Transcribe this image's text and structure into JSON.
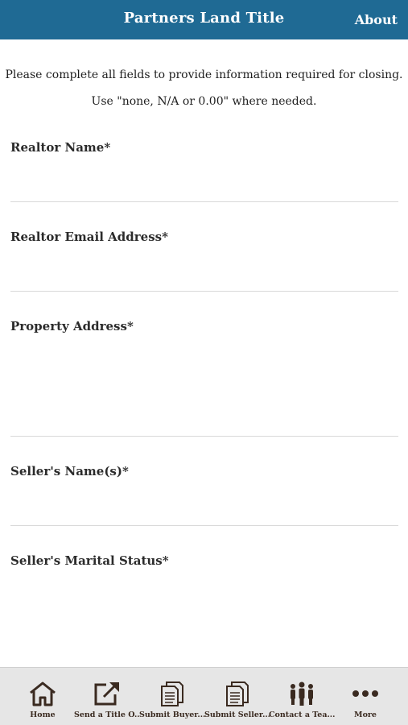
{
  "header": {
    "title": "Partners Land Title",
    "about": "About"
  },
  "intro": {
    "line1": "Please complete all fields to provide information required for closing.",
    "line2": "Use \"none, N/A or 0.00\" where needed."
  },
  "fields": [
    {
      "label": "Realtor Name*",
      "value": ""
    },
    {
      "label": "Realtor Email Address*",
      "value": ""
    },
    {
      "label": "Property Address*",
      "value": ""
    },
    {
      "label": "Seller's Name(s)*",
      "value": ""
    },
    {
      "label": "Seller's Marital Status*",
      "value": ""
    }
  ],
  "tabs": [
    {
      "label": "Home",
      "icon": "home-icon"
    },
    {
      "label": "Send a Title O...",
      "icon": "external-link-icon"
    },
    {
      "label": "Submit Buyer...",
      "icon": "document-icon"
    },
    {
      "label": "Submit Seller...",
      "icon": "document-icon"
    },
    {
      "label": "Contact a Tea...",
      "icon": "team-icon"
    },
    {
      "label": "More",
      "icon": "more-icon"
    }
  ],
  "colors": {
    "header_bg": "#1f6a94",
    "tab_icon": "#3a2a20",
    "tabbar_bg": "#e6e6e6"
  }
}
